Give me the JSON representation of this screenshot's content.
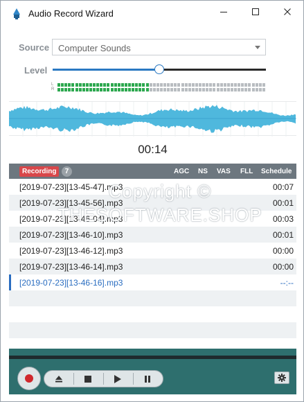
{
  "window": {
    "title": "Audio Record Wizard",
    "controls": {
      "minimize": "minimize-icon",
      "maximize": "maximize-icon",
      "close": "close-icon"
    }
  },
  "source": {
    "label": "Source",
    "value": "Computer Sounds"
  },
  "level": {
    "label": "Level",
    "value_fraction": 0.5
  },
  "meter": {
    "channels": [
      "L",
      "R"
    ],
    "total_segments": 59,
    "left_active_segments": 26,
    "right_active_segments": 26,
    "active_color": "#2da84f",
    "inactive_color": "#b9bdc1"
  },
  "waveform": {
    "color": "#4fb8dd"
  },
  "timer": "00:14",
  "list_header": {
    "status_badge": "Recording",
    "count": "7",
    "columns": [
      "AGC",
      "NS",
      "VAS",
      "FLL",
      "Schedule"
    ]
  },
  "recordings": [
    {
      "name": "[2019-07-23][13-45-47].mp3",
      "duration": "00:07",
      "active": false
    },
    {
      "name": "[2019-07-23][13-45-56].mp3",
      "duration": "00:01",
      "active": false
    },
    {
      "name": "[2019-07-23][13-46-04].mp3",
      "duration": "00:03",
      "active": false
    },
    {
      "name": "[2019-07-23][13-46-10].mp3",
      "duration": "00:01",
      "active": false
    },
    {
      "name": "[2019-07-23][13-46-12].mp3",
      "duration": "00:00",
      "active": false
    },
    {
      "name": "[2019-07-23][13-46-14].mp3",
      "duration": "00:00",
      "active": false
    },
    {
      "name": "[2019-07-23][13-46-16].mp3",
      "duration": "--:--",
      "active": true
    }
  ],
  "watermark": [
    "Copyright ©",
    "THESOFTWARE.SHOP"
  ],
  "transport": {
    "record": "record-icon",
    "eject": "eject-icon",
    "stop": "stop-icon",
    "play": "play-icon",
    "pause": "pause-icon",
    "settings": "gear-icon"
  },
  "colors": {
    "accent": "#2b79c2",
    "header_bg": "#6d777f",
    "record_badge": "#d8474a",
    "bottom_bar": "#2e6f6e"
  }
}
